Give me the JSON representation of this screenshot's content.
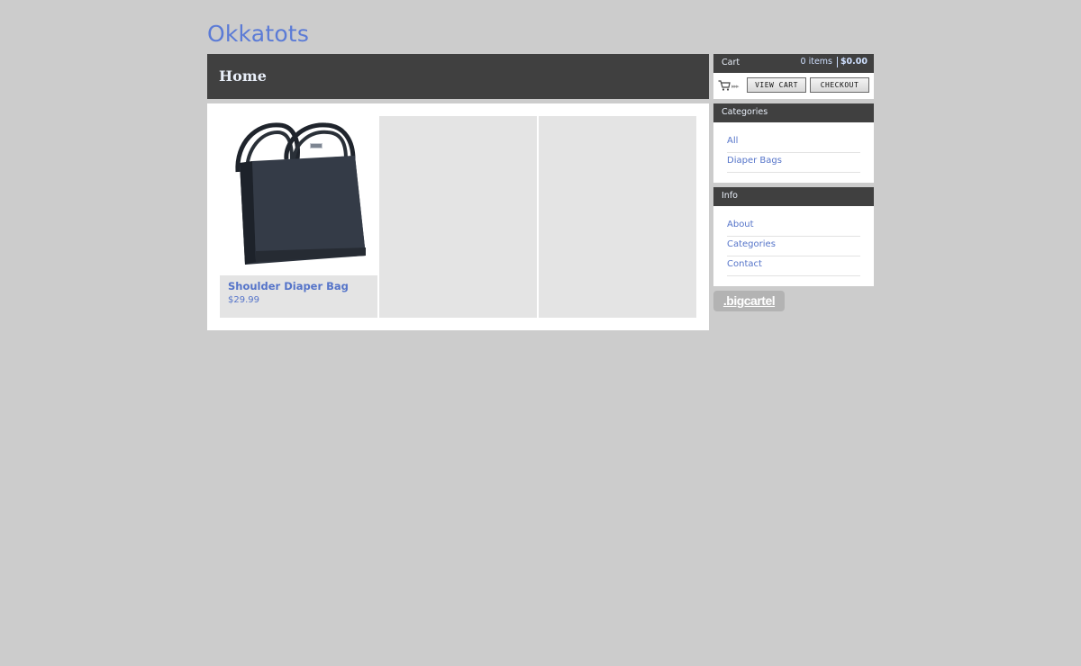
{
  "store": {
    "title": "Okkatots"
  },
  "page": {
    "heading": "Home"
  },
  "products": [
    {
      "name": "Shoulder Diaper Bag",
      "price": "$29.99",
      "image": "black-shoulder-bag-photo"
    }
  ],
  "cart": {
    "label": "Cart",
    "items": "0 items",
    "total": "$0.00",
    "view_cart_label": "VIEW CART",
    "checkout_label": "CHECKOUT"
  },
  "categories": {
    "title": "Categories",
    "items": [
      "All",
      "Diaper Bags"
    ]
  },
  "info": {
    "title": "Info",
    "items": [
      "About",
      "Categories",
      "Contact"
    ]
  },
  "badge": {
    "label": ".bigcartel"
  },
  "colors": {
    "background": "#cccccc",
    "header_bar": "#404040",
    "link": "#5574c9",
    "title": "#5b7bd6"
  }
}
